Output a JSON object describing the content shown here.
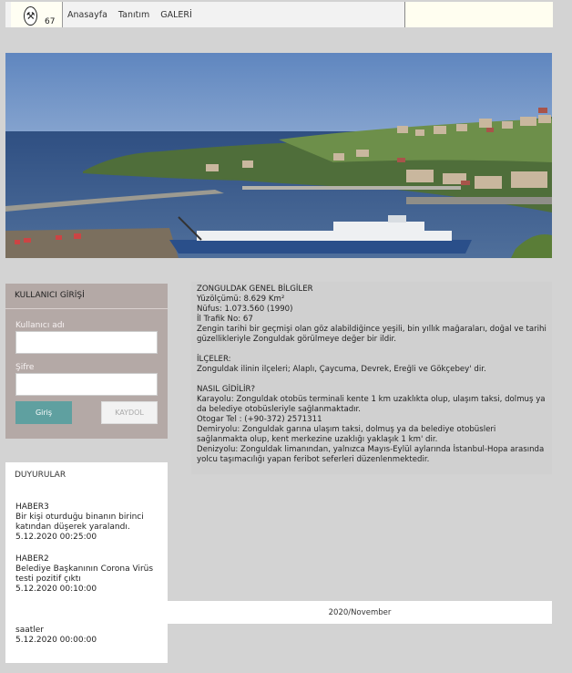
{
  "header": {
    "logo_number": "67",
    "nav": [
      "Anasayfa",
      "Tanıtım",
      "GALERİ"
    ]
  },
  "login": {
    "title": "KULLANICI GİRİŞİ",
    "username_label": "Kullanıcı adı",
    "password_label": "Şifre",
    "login_button": "Giriş",
    "register_button": "KAYDOL"
  },
  "news": {
    "title": "DUYURULAR",
    "items": [
      {
        "title": "HABER3",
        "body": "Bir kişi oturduğu binanın birinci katından düşerek yaralandı.",
        "date": "5.12.2020 00:25:00"
      },
      {
        "title": "HABER2",
        "body": "Belediye Başkanının Corona Virüs testi pozitif çıktı",
        "date": "5.12.2020 00:10:00"
      },
      {
        "title": "saatler",
        "body": "",
        "date": "5.12.2020 00:00:00"
      }
    ]
  },
  "info": {
    "title": "ZONGULDAK GENEL BİLGİLER",
    "area": "Yüzölçümü: 8.629 Km²",
    "population": "Nüfus: 1.073.560 (1990)",
    "traffic": "İl Trafik No: 67",
    "intro": "Zengin tarihi bir geçmişi olan göz alabildiğince yeşili, bin yıllık mağaraları, doğal ve tarihi güzellikleriyle Zonguldak görülmeye değer bir ildir.",
    "districts_title": "İLÇELER:",
    "districts": "Zonguldak ilinin ilçeleri; Alaplı, Çaycuma, Devrek, Ereğli ve Gökçebey' dir.",
    "howto_title": "NASIL GİDİLİR?",
    "road": "Karayolu: Zonguldak otobüs terminali kente 1 km uzaklıkta olup, ulaşım taksi, dolmuş ya da belediye otobüsleriyle sağlanmaktadır.",
    "bus_phone": "Otogar Tel : (+90-372) 2571311",
    "rail": "Demiryolu: Zonguldak garına ulaşım taksi, dolmuş ya da belediye otobüsleri sağlanmakta olup, kent merkezine uzaklığı yaklaşık 1 km' dir.",
    "sea": "Denizyolu: Zonguldak limanından, yalnızca Mayıs-Eylül aylarında İstanbul-Hopa arasında yolcu taşımacılığı yapan feribot seferleri düzenlenmektedir."
  },
  "footer": {
    "month": "2020/November"
  },
  "colors": {
    "background": "#d3d3d3",
    "panel": "#b4a9a6",
    "accent_button": "#5fa0a0"
  }
}
